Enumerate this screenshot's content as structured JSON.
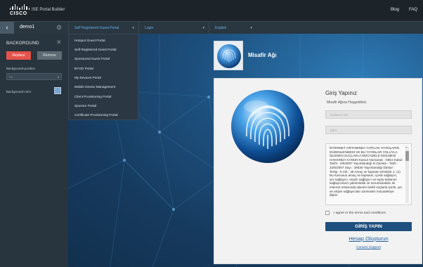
{
  "header": {
    "logo_text": "CISCO",
    "app_title": "ISE Portal Builder",
    "links": [
      "Blog",
      "FAQ"
    ]
  },
  "toolbar": {
    "back_icon": "chevron-left-icon",
    "site_name": "demo1",
    "settings_icon": "gear-icon",
    "portal_select": "Self Registered Guest Portal",
    "page_select": "Login",
    "language_select": "English",
    "accent": "#5fb4ea"
  },
  "left_panel": {
    "title": "BACKGROUND",
    "close_icon": "close-icon",
    "replace_label": "Replace",
    "remove_label": "Remove",
    "bg_position_label": "Background-position",
    "bg_position_value": "Fill",
    "bg_color_label": "Background-color",
    "bg_color_value": "#7aa6d2",
    "replace_color": "#e5534b"
  },
  "portal_menu": {
    "items": [
      "Hotspot Guest Portal",
      "Self Registered Guest Portal",
      "Sponsored Guest Portal",
      "BYOD Portal",
      "My Devices Portal",
      "Mobile Device Management",
      "Client Provisioning Portal",
      "Sponsor Portal",
      "Certificate Provisioning Portal"
    ]
  },
  "preview": {
    "banner_title": "Misafir Ağı",
    "login": {
      "title": "Giriş Yapınız",
      "subtitle": "Misafir Ağına Hoşgeldiniz.",
      "username_placeholder": "Kullanıcı Adı",
      "password_placeholder": "Şifre",
      "aup_text": "İNTERNET ORTAMINDA YAPILAN YAYINLARIN DÜZENLENMESİ VE BU YAYINLAR YOLUYLA İŞLENEN SUÇLARLA MÜCADELE EDİLMESİ HAKKINDA KANUN Kanun Numarası : 5651 Kabul Tarihi : 4/5/2007 Yayımlandığı R.Gazete : Tarih : 23/5/2007 Sayı : 26530 Yayımlandığı Düstur : Tertip : 5 Cilt : 46 Amaç ve kapsam MADDE 1- (1) Bu Kanunun amaç ve kapsamı; içerik sağlayıcı, yer sağlayıcı, erişim sağlayıcı ve toplu kullanım sağlayıcıların yükümlülük ve sorumlulukları ile internet ortamında işlenen belirli suçlarla içerik, yer ve erişim sağlayıcıları üzerinden mücadeleye ilişkin",
      "agree_label": "I agree to the terms and conditions",
      "signin_label": "GİRİŞ YAPIN",
      "create_account_label": "Hesap Oluşturun",
      "support_label": "Contact Support"
    }
  }
}
